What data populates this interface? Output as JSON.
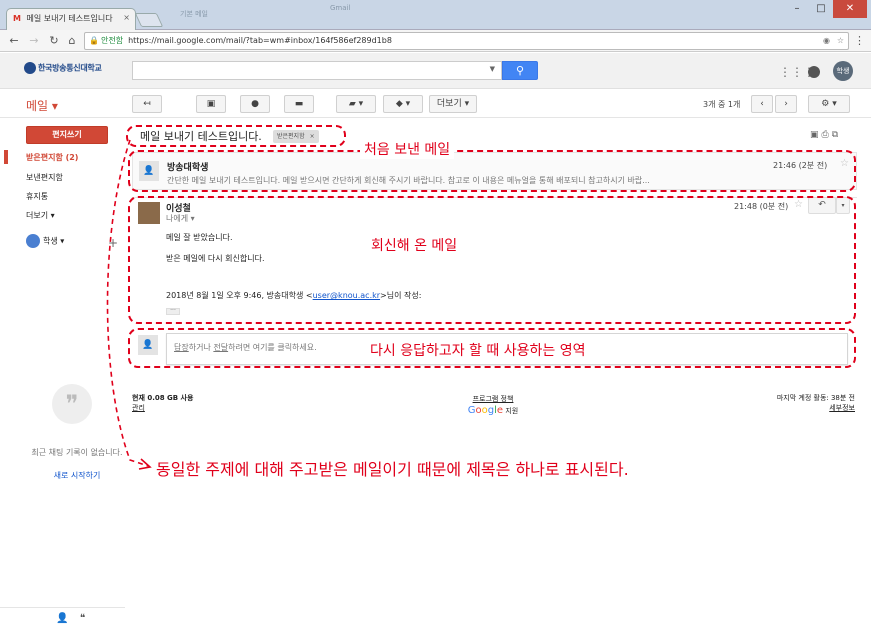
{
  "browser": {
    "tab_title": "메일 보내기 테스트입니다",
    "window_title": "기본 메일",
    "window_caption": "Gmail",
    "secure_text": "안전함",
    "url": "https://mail.google.com/mail/?tab=wm#inbox/164f586ef289d1b8"
  },
  "header": {
    "logo_text": "한국방송통신대학교",
    "search_placeholder": "",
    "avatar_text": "학생"
  },
  "actionbar": {
    "mail_label": "메일 ▾",
    "more_label": "더보기 ▾",
    "count_text": "3개 중 1개"
  },
  "sidebar": {
    "compose_label": "편지쓰기",
    "items": [
      {
        "label": "받은편지함 (2)"
      },
      {
        "label": "보낸편지함"
      },
      {
        "label": "휴지통"
      },
      {
        "label": "더보기 ▾"
      }
    ],
    "hangout_user": "학생 ▾",
    "chat_empty": "최근 채팅 기록이 없습니다.",
    "chat_start": "새로 시작하기"
  },
  "thread": {
    "subject": "메일 보내기 테스트입니다.",
    "label_badge": "받은편지함",
    "messages": [
      {
        "sender": "방송대학생",
        "snippet": "간단한 메일 보내기 테스트입니다. 메일 받으시면 간단하게 회신해 주시기 바랍니다. 참고로 이 내용은 메뉴얼을 통해 배포되니 참고하시기 바랍...",
        "time": "21:46 (2분 전)"
      },
      {
        "sender": "이성철",
        "to": "나에게",
        "time": "21:48 (0분 전)",
        "body": [
          "메일 잘 받았습니다.",
          "받은 메일에 다시 회신합니다."
        ],
        "quote_prefix": "2018년 8월 1일 오후 9:46, 방송대학생 <",
        "quote_email": "user@knou.ac.kr",
        "quote_suffix": ">님이 작성:"
      }
    ],
    "reply_prompt_reply": "답장",
    "reply_prompt_mid": "하거나 ",
    "reply_prompt_forward": "전달",
    "reply_prompt_end": "하려면 여기를 클릭하세요."
  },
  "footer": {
    "usage": "현재 0.08 GB 사용",
    "manage": "관리",
    "policy": "프로그램 정책",
    "powered": "지원",
    "google_logo": "Google",
    "last_activity": "마지막 계정 활동: 38분 전",
    "details": "세부정보"
  },
  "annotations": {
    "first_mail": "처음 보낸 메일",
    "reply_mail": "회신해 온 메일",
    "reply_area": "다시 응답하고자 할 때 사용하는 영역",
    "subject_note": "동일한 주제에 대해 주고받은 메일이기 때문에 제목은 하나로 표시된다."
  },
  "colors": {
    "accent_red": "#d14836",
    "annotation_red": "#e0001b",
    "search_blue": "#4285f4",
    "link_blue": "#1155cc"
  }
}
